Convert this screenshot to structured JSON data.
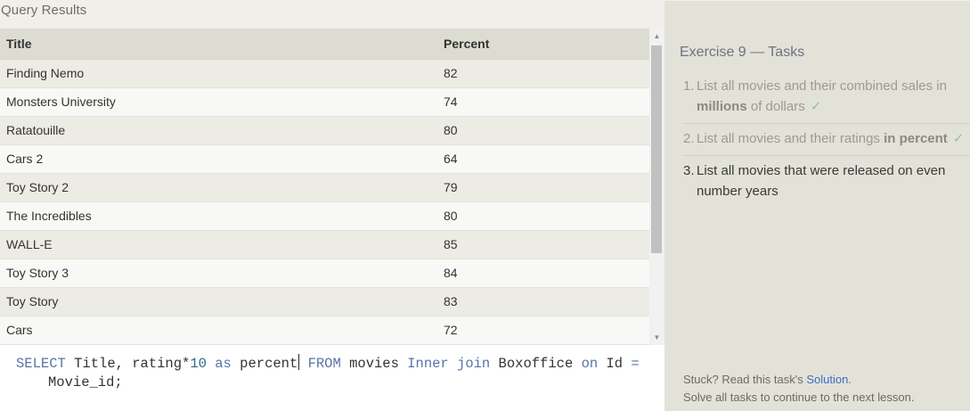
{
  "results": {
    "header": "Query Results",
    "columns": [
      "Title",
      "Percent"
    ],
    "rows": [
      [
        "Finding Nemo",
        "82"
      ],
      [
        "Monsters University",
        "74"
      ],
      [
        "Ratatouille",
        "80"
      ],
      [
        "Cars 2",
        "64"
      ],
      [
        "Toy Story 2",
        "79"
      ],
      [
        "The Incredibles",
        "80"
      ],
      [
        "WALL-E",
        "85"
      ],
      [
        "Toy Story 3",
        "84"
      ],
      [
        "Toy Story",
        "83"
      ],
      [
        "Cars",
        "72"
      ]
    ]
  },
  "editor": {
    "line1": {
      "kw_select": "SELECT",
      "t1": " Title, rating*",
      "num": "10",
      "kw_as": " as",
      "t2": " percent",
      "kw_from": " FROM",
      "t3": " movies ",
      "kw_inner": "Inner join",
      "t4": " Boxoffice ",
      "kw_on": "on",
      "t5": " Id ",
      "eq": "="
    },
    "line2": "Movie_id;"
  },
  "tasks": {
    "title": "Exercise 9 — Tasks",
    "items": [
      {
        "num": "1.",
        "text_a": "List all movies and their combined sales in ",
        "bold": "millions",
        "text_b": " of dollars",
        "check": "✓"
      },
      {
        "num": "2.",
        "text_a": "List all movies and their ratings ",
        "bold": "in percent",
        "text_b": "",
        "check": "✓"
      },
      {
        "num": "3.",
        "text_a": "List all movies that were released on even number years"
      }
    ]
  },
  "footer": {
    "stuck": "Stuck? Read this task's ",
    "link": "Solution.",
    "line2": "Solve all tasks to continue to the next lesson."
  },
  "colors": {
    "accent_link": "#3b6ec2",
    "check": "#8dc49a",
    "keyword": "#5a73a8"
  }
}
